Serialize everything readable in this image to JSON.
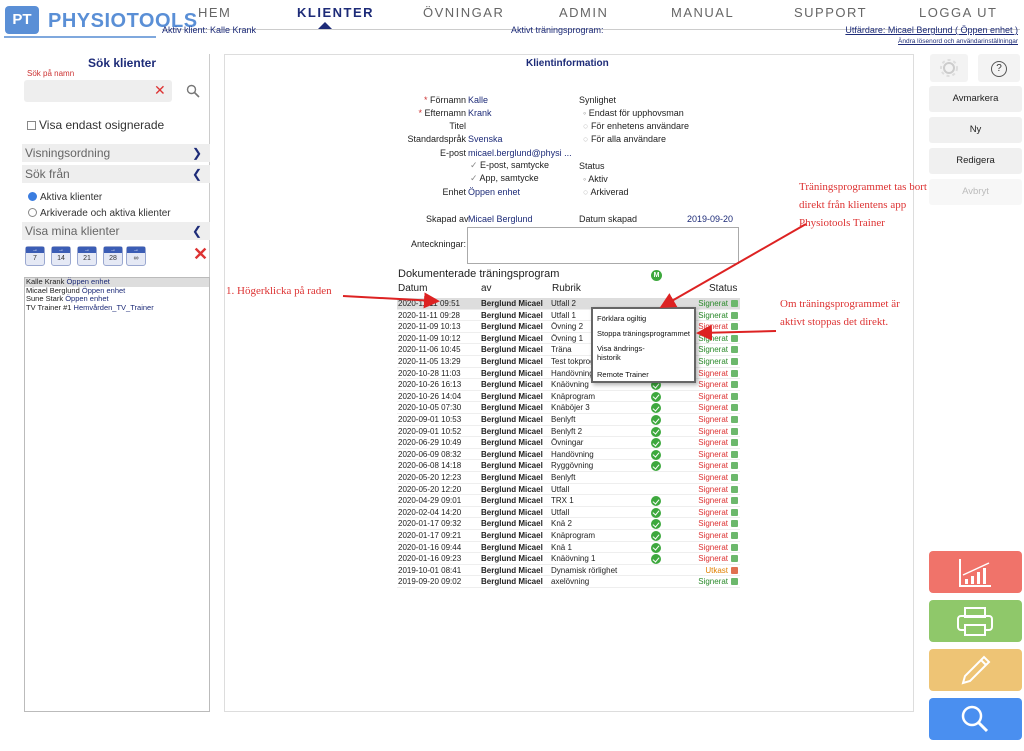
{
  "header": {
    "logo_badge": "PT",
    "logo_text": "PHYSIOTOOLS",
    "nav": [
      "HEM",
      "KLIENTER",
      "ÖVNINGAR",
      "ADMIN",
      "MANUAL",
      "SUPPORT",
      "LOGGA UT"
    ],
    "active_client": "Aktiv klient: Kalle Krank",
    "active_program": "Aktivt träningsprogram:",
    "issuer": "Utfärdare: Micael Berglund ( Öppen enhet )",
    "change_password": "Ändra lösenord och användarinställningar"
  },
  "left": {
    "title": "Sök klienter",
    "search_label": "Sök på namn",
    "search_value": "",
    "show_unsigned": "Visa endast osignerade",
    "sort_order": "Visningsordning",
    "search_from": "Sök från",
    "radio_active": "Aktiva klienter",
    "radio_archived": "Arkiverade och aktiva klienter",
    "show_my_clients": "Visa mina klienter",
    "day_buttons": [
      "7",
      "14",
      "21",
      "28",
      "∞"
    ],
    "clients": [
      {
        "name": "Kalle Krank",
        "unit": "Öppen enhet"
      },
      {
        "name": "Micael Berglund",
        "unit": "Öppen enhet"
      },
      {
        "name": "Sune Stark",
        "unit": "Öppen enhet"
      },
      {
        "name": "TV Trainer #1",
        "unit": "Hemvården_TV_Trainer"
      }
    ]
  },
  "main": {
    "title": "Klientinformation",
    "firstname_label": "Förnamn",
    "firstname": "Kalle",
    "lastname_label": "Efternamn",
    "lastname": "Krank",
    "title_label": "Titel",
    "language_label": "Standardspråk",
    "language": "Svenska",
    "email_label": "E-post",
    "email": "micael.berglund@physi ...",
    "consent_email": "E-post, samtycke",
    "consent_app": "App, samtycke",
    "unit_label": "Enhet",
    "unit": "Öppen enhet",
    "visibility_label": "Synlighet",
    "vis_options": [
      "Endast för upphovsman",
      "För enhetens användare",
      "För alla användare"
    ],
    "status_label": "Status",
    "status_options": [
      "Aktiv",
      "Arkiverad"
    ],
    "created_by_label": "Skapad av",
    "created_by": "Micael Berglund",
    "created_date_label": "Datum skapad",
    "created_date": "2019-09-20",
    "notes_label": "Anteckningar:",
    "programs_title": "Dokumenterade träningsprogram",
    "col_date": "Datum",
    "col_by": "av",
    "col_title": "Rubrik",
    "col_m": "M",
    "col_status": "Status",
    "rows": [
      {
        "date": "2020-11-11 09:51",
        "by": "Berglund Micael",
        "title": "Utfall 2",
        "m": false,
        "status": "Signerat",
        "color": "green"
      },
      {
        "date": "2020-11-11 09:28",
        "by": "Berglund Micael",
        "title": "Utfall 1",
        "m": false,
        "status": "Signerat",
        "color": "green"
      },
      {
        "date": "2020-11-09 10:13",
        "by": "Berglund Micael",
        "title": "Övning 2",
        "m": false,
        "status": "Signerat",
        "color": "red"
      },
      {
        "date": "2020-11-09 10:12",
        "by": "Berglund Micael",
        "title": "Övning 1",
        "m": false,
        "status": "Signerat",
        "color": "green"
      },
      {
        "date": "2020-11-06 10:45",
        "by": "Berglund Micael",
        "title": "Träna",
        "m": false,
        "status": "Signerat",
        "color": "green"
      },
      {
        "date": "2020-11-05 13:29",
        "by": "Berglund Micael",
        "title": "Test tokprog",
        "m": false,
        "status": "Signerat",
        "color": "green"
      },
      {
        "date": "2020-10-28 11:03",
        "by": "Berglund Micael",
        "title": "Handövning",
        "m": false,
        "status": "Signerat",
        "color": "red"
      },
      {
        "date": "2020-10-26 16:13",
        "by": "Berglund Micael",
        "title": "Knäövning",
        "m": true,
        "status": "Signerat",
        "color": "red"
      },
      {
        "date": "2020-10-26 14:04",
        "by": "Berglund Micael",
        "title": "Knäprogram",
        "m": true,
        "status": "Signerat",
        "color": "red"
      },
      {
        "date": "2020-10-05 07:30",
        "by": "Berglund Micael",
        "title": "Knäböjer 3",
        "m": true,
        "status": "Signerat",
        "color": "red"
      },
      {
        "date": "2020-09-01 10:53",
        "by": "Berglund Micael",
        "title": "Benlyft",
        "m": true,
        "status": "Signerat",
        "color": "red"
      },
      {
        "date": "2020-09-01 10:52",
        "by": "Berglund Micael",
        "title": "Benlyft 2",
        "m": true,
        "status": "Signerat",
        "color": "red"
      },
      {
        "date": "2020-06-29 10:49",
        "by": "Berglund Micael",
        "title": "Övningar",
        "m": true,
        "status": "Signerat",
        "color": "red"
      },
      {
        "date": "2020-06-09 08:32",
        "by": "Berglund Micael",
        "title": "Handövning",
        "m": true,
        "status": "Signerat",
        "color": "red"
      },
      {
        "date": "2020-06-08 14:18",
        "by": "Berglund Micael",
        "title": "Ryggövning",
        "m": true,
        "status": "Signerat",
        "color": "red"
      },
      {
        "date": "2020-05-20 12:23",
        "by": "Berglund Micael",
        "title": "Benlyft",
        "m": false,
        "status": "Signerat",
        "color": "red"
      },
      {
        "date": "2020-05-20 12:20",
        "by": "Berglund Micael",
        "title": "Utfall",
        "m": false,
        "status": "Signerat",
        "color": "red"
      },
      {
        "date": "2020-04-29 09:01",
        "by": "Berglund Micael",
        "title": "TRX 1",
        "m": true,
        "status": "Signerat",
        "color": "red"
      },
      {
        "date": "2020-02-04 14:20",
        "by": "Berglund Micael",
        "title": "Utfall",
        "m": true,
        "status": "Signerat",
        "color": "red"
      },
      {
        "date": "2020-01-17 09:32",
        "by": "Berglund Micael",
        "title": "Knä 2",
        "m": true,
        "status": "Signerat",
        "color": "red"
      },
      {
        "date": "2020-01-17 09:21",
        "by": "Berglund Micael",
        "title": "Knäprogram",
        "m": true,
        "status": "Signerat",
        "color": "red"
      },
      {
        "date": "2020-01-16 09:44",
        "by": "Berglund Micael",
        "title": "Knä 1",
        "m": true,
        "status": "Signerat",
        "color": "red"
      },
      {
        "date": "2020-01-16 09:23",
        "by": "Berglund Micael",
        "title": "Knäövning 1",
        "m": true,
        "status": "Signerat",
        "color": "red"
      },
      {
        "date": "2019-10-01 08:41",
        "by": "Berglund Micael",
        "title": "Dynamisk rörlighet",
        "m": false,
        "status": "Utkast",
        "color": "orange"
      },
      {
        "date": "2019-09-20 09:02",
        "by": "Berglund Micael",
        "title": "axelövning",
        "m": false,
        "status": "Signerat",
        "color": "green"
      }
    ]
  },
  "context_menu": [
    "Förklara ogiltig",
    "Stoppa träningsprogrammet",
    "Visa ändrings-",
    "historik",
    "Remote Trainer"
  ],
  "annotations": {
    "a1": "1. Högerklicka på raden",
    "a2_lines": [
      "Träningsprogrammet tas bort",
      "direkt från klientens app",
      "Physiotools Trainer"
    ],
    "a3_lines": [
      "Om träningsprogrammet är",
      "aktivt stoppas det direkt."
    ]
  },
  "right": {
    "buttons": [
      "Avmarkera",
      "Ny",
      "Redigera",
      "Avbryt"
    ],
    "help": "?",
    "big_colors": [
      "#f0736a",
      "#8fc86a",
      "#eec475",
      "#4a8ff0"
    ],
    "big_icons": [
      "chart-icon",
      "printer-icon",
      "pencil-icon",
      "search-icon"
    ]
  },
  "colors": {
    "brand": "#5a8fd6",
    "nav_active": "#1d2b78",
    "annotation": "#dd2222"
  }
}
